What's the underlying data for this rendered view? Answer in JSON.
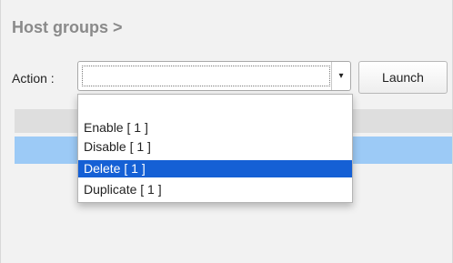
{
  "header": {
    "title": "Host groups >"
  },
  "action": {
    "label": "Action :",
    "selected_value": "",
    "launch_label": "Launch"
  },
  "dropdown": {
    "items": [
      {
        "label": "Enable [ 1 ]",
        "selected": false
      },
      {
        "label": "Disable [ 1 ]",
        "selected": false
      },
      {
        "label": "Delete [ 1 ]",
        "selected": true
      },
      {
        "label": "Duplicate [ 1 ]",
        "selected": false
      }
    ]
  },
  "colors": {
    "selection_blue": "#1560d5",
    "row_highlight": "#9ccaf6",
    "title_gray": "#8a8a8a"
  }
}
